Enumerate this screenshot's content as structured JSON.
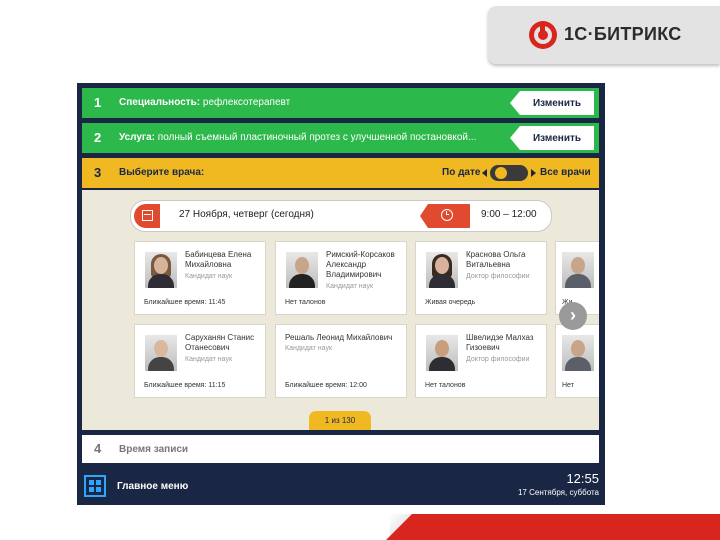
{
  "logo": {
    "text": "1С·БИТРИКС",
    "brand_color": "#d8261e"
  },
  "steps": {
    "s1": {
      "num": "1",
      "label": "Специальность:",
      "value": "рефлексотерапевт",
      "change": "Изменить"
    },
    "s2": {
      "num": "2",
      "label": "Услуга:",
      "value": "полный съемный пластиночный протез с улучшенной постановкой...",
      "change": "Изменить"
    },
    "s3": {
      "num": "3",
      "label": "Выберите врача:",
      "sort_date": "По дате",
      "sort_all": "Все врачи"
    },
    "s4": {
      "num": "4",
      "label": "Время записи"
    }
  },
  "datebar": {
    "date": "27 Ноября, четверг (сегодня)",
    "time": "9:00 – 12:00"
  },
  "doctors": [
    {
      "name": "Бабинцева Елена Михайловна",
      "degree": "Кандидат наук",
      "slot": "Ближайшее время: 11:45"
    },
    {
      "name": "Римский-Корсаков Александр Владимирович",
      "degree": "Кандидат наук",
      "slot": "Нет талонов"
    },
    {
      "name": "Краснова Ольга Витальевна",
      "degree": "Доктор философии",
      "slot": "Живая очередь"
    },
    {
      "name": "Саруханян Станис Отанесович",
      "degree": "Кандидат наук",
      "slot": "Ближайшее время: 11:15"
    },
    {
      "name": "Решаль Леонид Михайлович",
      "degree": "Кандидат наук",
      "slot": "Ближайшее время: 12:00"
    },
    {
      "name": "Швелидзе Малхаз Гизоевич",
      "degree": "Доктор философии",
      "slot": "Нет талонов"
    }
  ],
  "peek": {
    "top": "Жи",
    "bottom": "Нет"
  },
  "pager": "1 из 130",
  "footer": {
    "menu": "Главное меню",
    "time": "12:55",
    "date": "17 Сентября, суббота"
  },
  "colors": {
    "navy": "#1a2744",
    "green": "#2db84b",
    "yellow": "#f0b922",
    "red": "#e04a2f"
  }
}
